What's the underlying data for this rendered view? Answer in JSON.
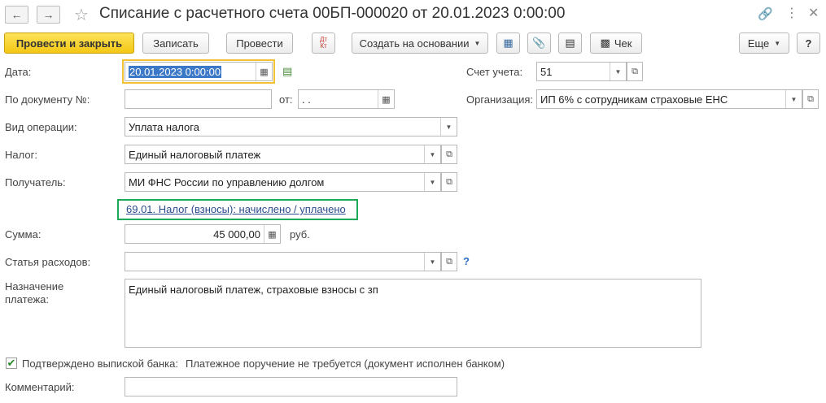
{
  "title": "Списание с расчетного счета 00БП-000020 от 20.01.2023 0:00:00",
  "toolbar": {
    "post_close": "Провести и закрыть",
    "save": "Записать",
    "post": "Провести",
    "dtkt": "Дт Кт",
    "create_based": "Создать на основании",
    "receipt": "Чек",
    "more": "Еще",
    "help": "?"
  },
  "form": {
    "date_label": "Дата:",
    "date_value": "20.01.2023  0:00:00",
    "docnum_label": "По документу №:",
    "docnum_value": "",
    "from_label": "от:",
    "from_value": "  .  .",
    "account_label": "Счет учета:",
    "account_value": "51",
    "org_label": "Организация:",
    "org_value": "ИП 6% с сотрудникам страховые ЕНС",
    "optype_label": "Вид операции:",
    "optype_value": "Уплата налога",
    "tax_label": "Налог:",
    "tax_value": "Единый налоговый платеж",
    "recipient_label": "Получатель:",
    "recipient_value": "МИ ФНС России по управлению долгом",
    "account_link": "69.01. Налог (взносы): начислено / уплачено",
    "sum_label": "Сумма:",
    "sum_value": "45 000,00",
    "currency": "руб.",
    "expense_label": "Статья расходов:",
    "expense_value": "",
    "purpose_label_1": "Назначение",
    "purpose_label_2": "платежа:",
    "purpose_value": "Единый налоговый платеж, страховые  взносы с зп",
    "confirmed_label": "Подтверждено выпиской банка:",
    "confirmed_text": "Платежное поручение не требуется (документ исполнен банком)",
    "comment_label": "Комментарий:",
    "comment_value": ""
  },
  "colors": {
    "primary_button": "#f3c714",
    "date_highlight": "#f1c232",
    "link_highlight": "#1faa59",
    "link_text": "#2a4b8d"
  }
}
